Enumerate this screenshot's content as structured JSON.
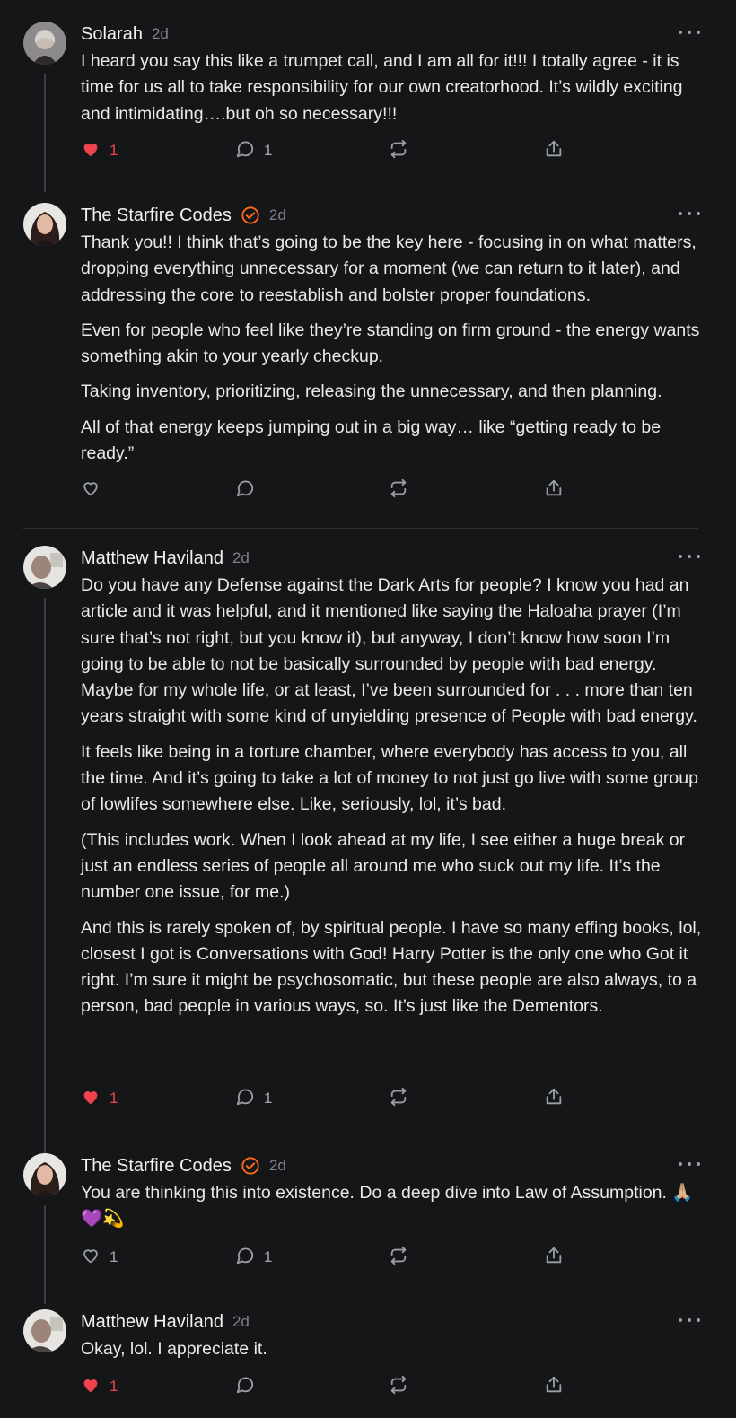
{
  "comments": [
    {
      "author": "Solarah",
      "time": "2d",
      "verified": false,
      "paragraphs": [
        "I heard you say this like a trumpet call, and I am all for it!!! I totally agree - it is time for us all to take responsibility for our own creatorhood. It’s wildly exciting and intimidating….but oh so necessary!!!"
      ],
      "likes": "1",
      "liked": true,
      "replies": "1"
    },
    {
      "author": "The Starfire Codes",
      "time": "2d",
      "verified": true,
      "paragraphs": [
        "Thank you!! I think that’s going to be the key here - focusing in on what matters, dropping everything unnecessary for a moment (we can return to it later), and addressing the core to reestablish and bolster proper foundations.",
        "Even for people who feel like they’re standing on firm ground - the energy wants something akin to your yearly checkup.",
        "Taking inventory, prioritizing, releasing the unnecessary, and then planning.",
        "All of that energy keeps jumping out in a big way… like “getting ready to be ready.”"
      ],
      "likes": "",
      "liked": false,
      "replies": ""
    },
    {
      "author": "Matthew Haviland",
      "time": "2d",
      "verified": false,
      "paragraphs": [
        "Do you have any Defense against the Dark Arts for people? I know you had an article and it was helpful, and it mentioned like saying the Haloaha prayer (I’m sure that’s not right, but you know it), but anyway, I don’t know how soon I’m going to be able to not be basically surrounded by people with bad energy. Maybe for my whole life, or at least, I’ve been surrounded for . . . more than ten years straight with some kind of unyielding presence of People with bad energy.",
        "It feels like being in a torture chamber, where everybody has access to you, all the time. And it’s going to take a lot of money to not just go live with some group of lowlifes somewhere else. Like, seriously, lol, it’s bad.",
        "(This includes work. When I look ahead at my life, I see either a huge break or just an endless series of people all around me who suck out my life. It’s the number one issue, for me.)",
        "And this is rarely spoken of, by spiritual people. I have so many effing books, lol, closest I got is Conversations with God! Harry Potter is the only one who Got it right. I’m sure it might be psychosomatic, but these people are also always, to a person, bad people in various ways, so. It’s just like the Dementors."
      ],
      "likes": "1",
      "liked": true,
      "replies": "1"
    },
    {
      "author": "The Starfire Codes",
      "time": "2d",
      "verified": true,
      "paragraphs": [
        "You are thinking this into existence. Do a deep dive into Law of Assumption. 🙏🏼💜💫"
      ],
      "likes": "1",
      "liked": false,
      "replies": "1"
    },
    {
      "author": "Matthew Haviland",
      "time": "2d",
      "verified": false,
      "paragraphs": [
        "Okay, lol. I appreciate it."
      ],
      "likes": "1",
      "liked": true,
      "replies": ""
    }
  ],
  "icons": {
    "like": "heart-icon",
    "reply": "speech-bubble-icon",
    "restack": "repost-icon",
    "share": "share-icon",
    "more": "ellipsis-icon",
    "verified": "check-badge-icon"
  },
  "colors": {
    "background": "#151618",
    "liked": "#f0434e",
    "verified": "#ff6b1a",
    "muted": "#7e8188"
  }
}
